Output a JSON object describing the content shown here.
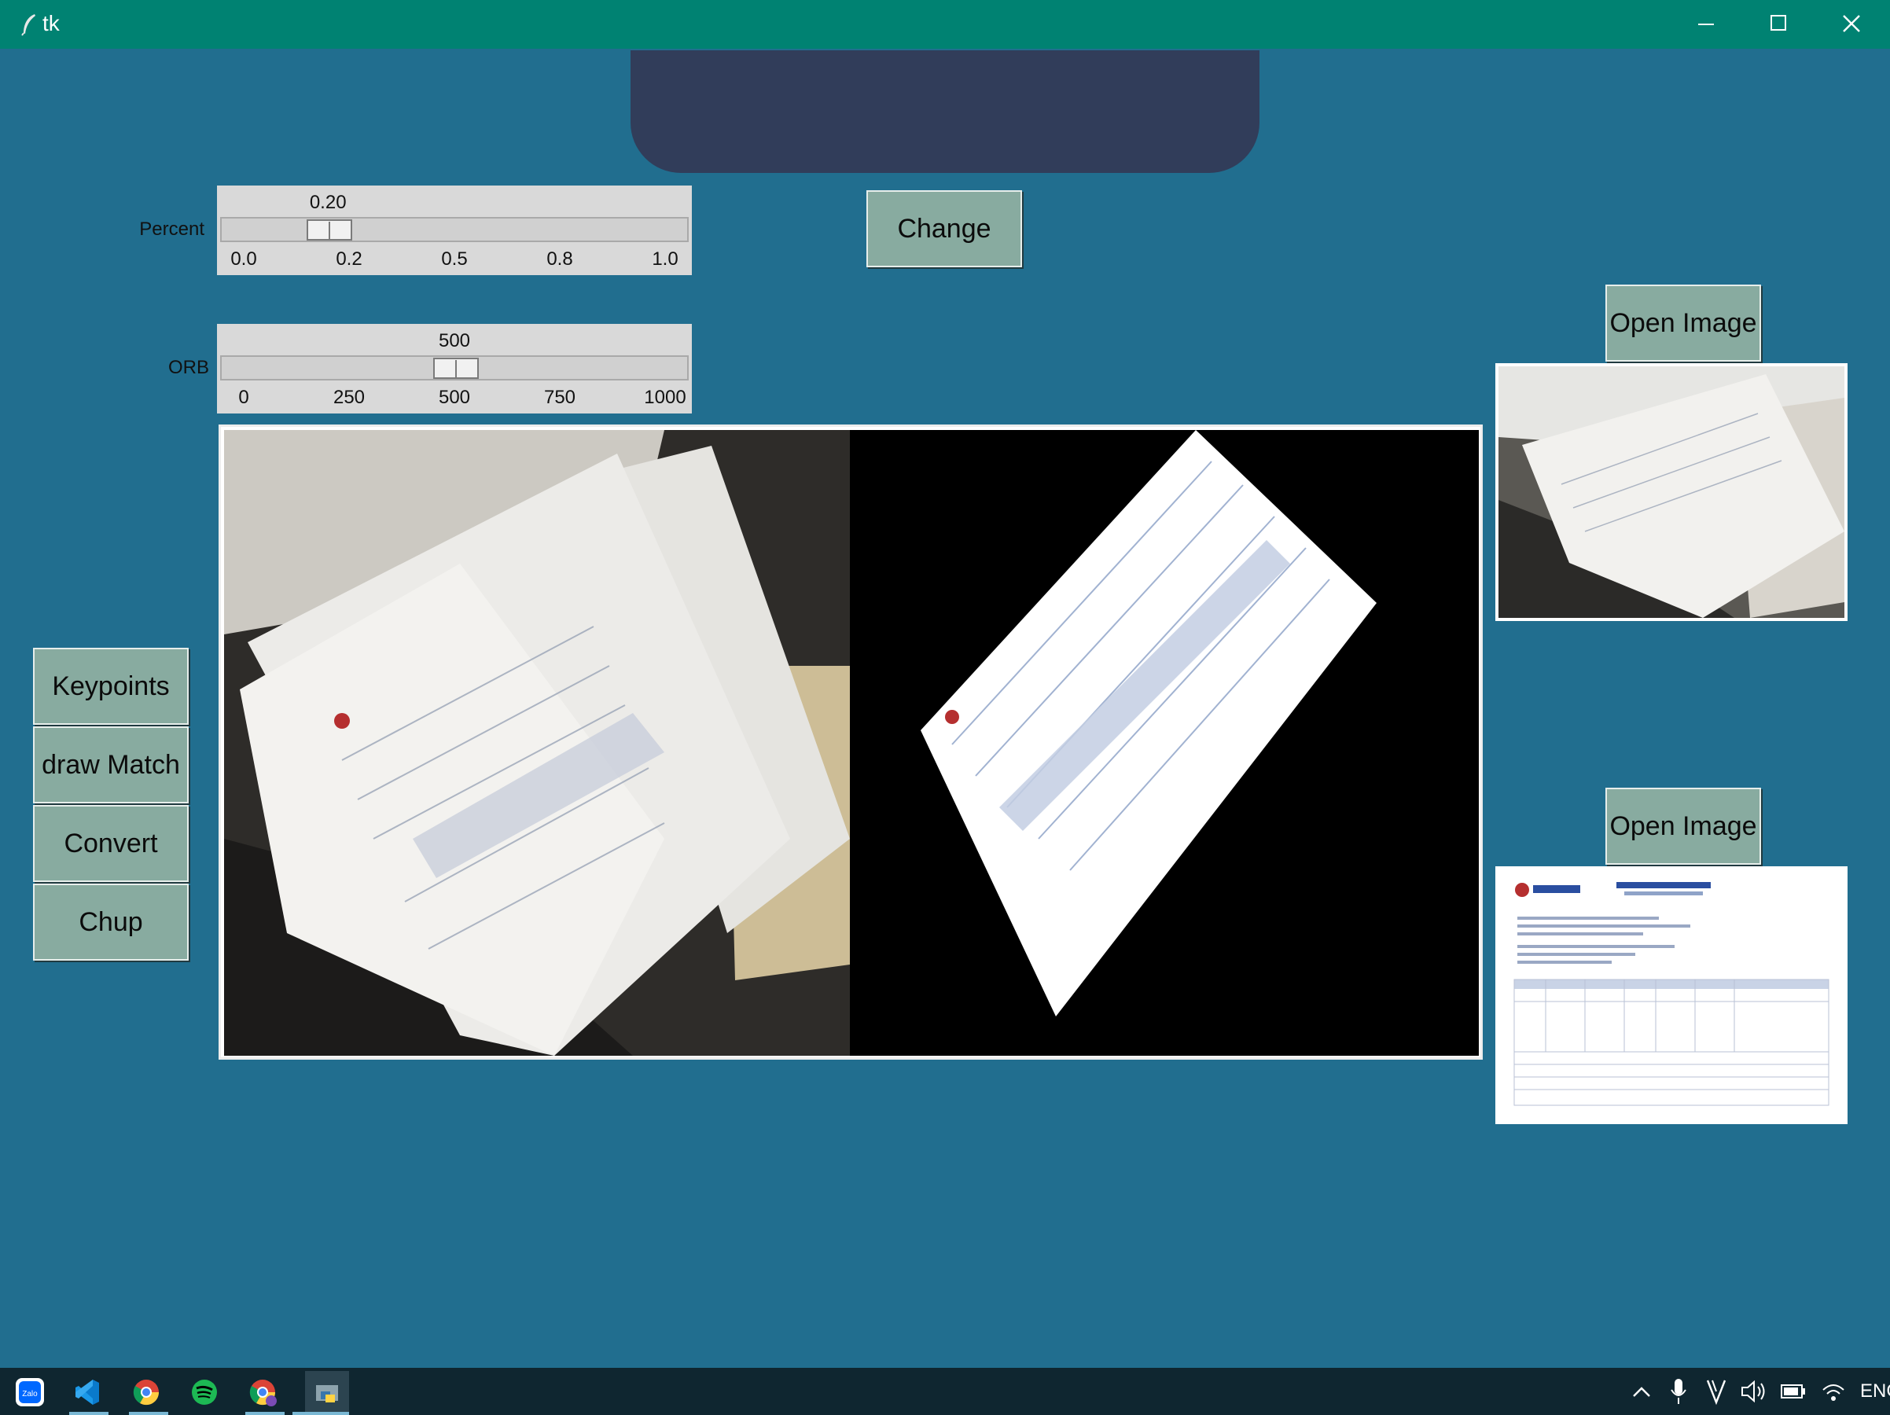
{
  "window": {
    "title": "tk"
  },
  "percent_scale": {
    "label": "Percent",
    "value": "0.20",
    "ticks": [
      "0.0",
      "0.2",
      "0.5",
      "0.8",
      "1.0"
    ],
    "fraction": 0.2
  },
  "orb_scale": {
    "label": "ORB",
    "value": "500",
    "ticks": [
      "0",
      "250",
      "500",
      "750",
      "1000"
    ],
    "fraction": 0.5
  },
  "buttons": {
    "change": "Change",
    "open_image_1": "Open Image",
    "open_image_2": "Open Image",
    "keypoints": "Keypoints",
    "draw_match": "draw Match",
    "convert": "Convert",
    "chup": "Chup"
  },
  "taskbar": {
    "apps": [
      "zalo-icon",
      "vscode-icon",
      "chrome-icon",
      "spotify-icon",
      "chrome-profile-icon",
      "python-icon"
    ],
    "lang": "ENG"
  },
  "colors": {
    "window_bg": "#216e8f",
    "titlebar": "#008272",
    "button": "#88aba0",
    "top_panel": "#313d5a"
  }
}
